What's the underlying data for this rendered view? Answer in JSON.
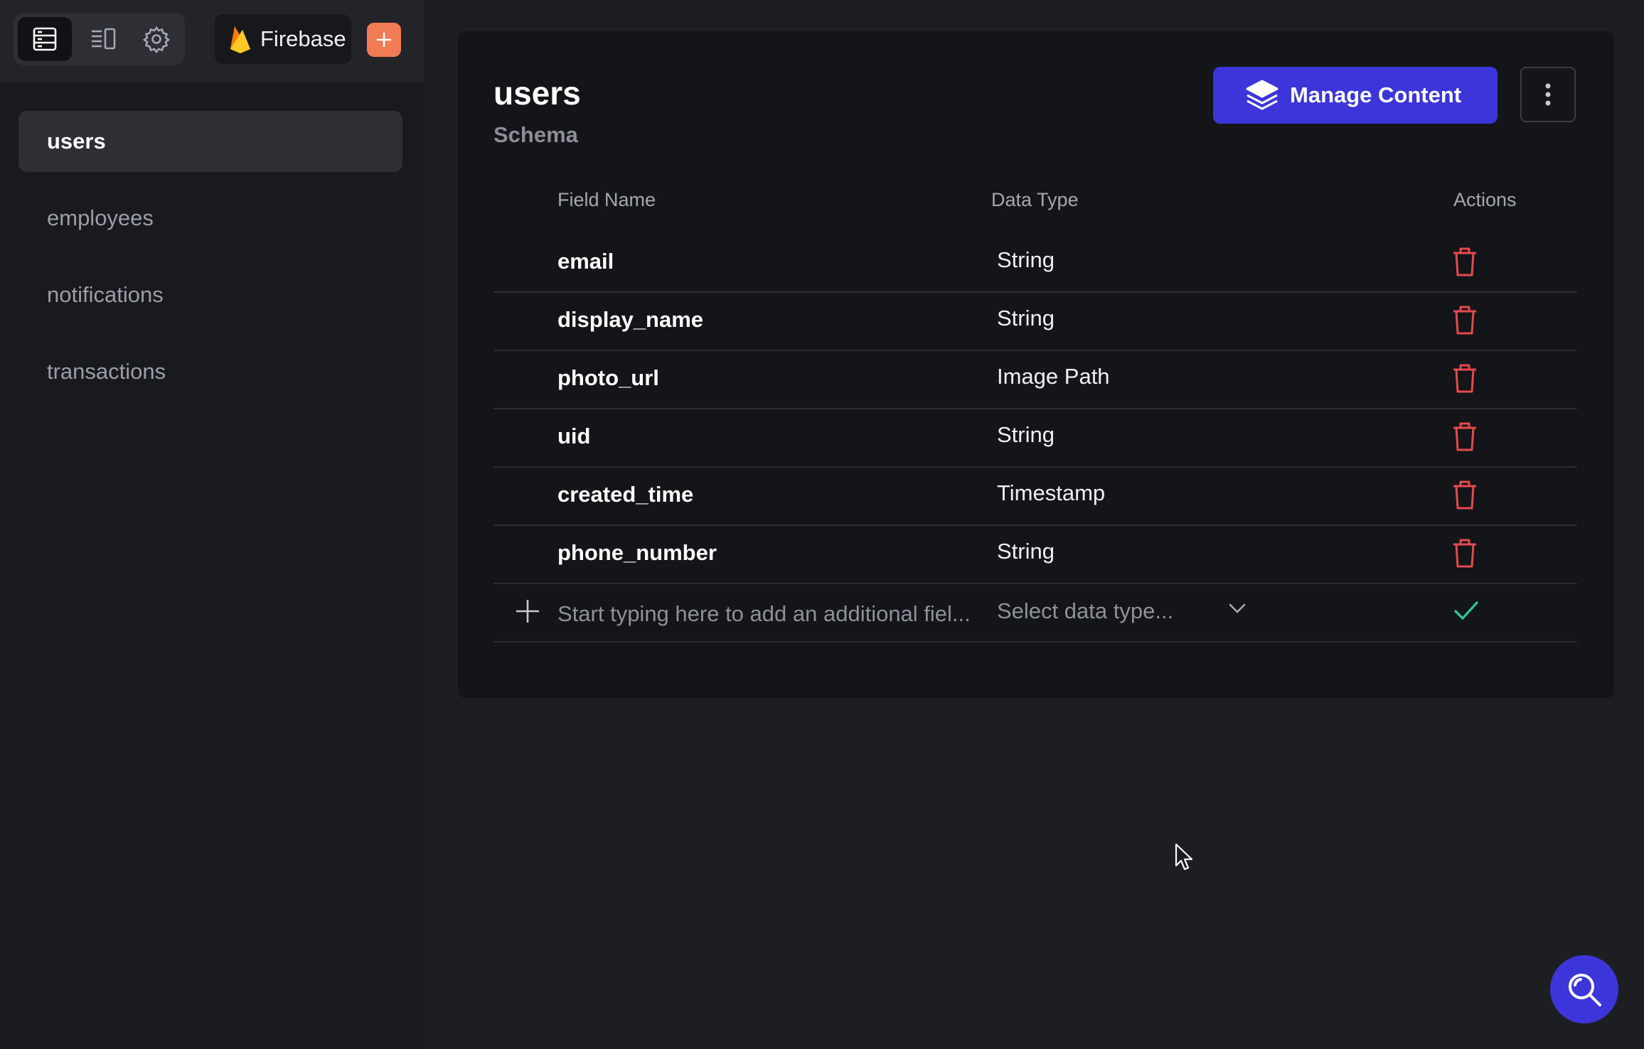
{
  "sidebar": {
    "provider_name": "Firebase",
    "collections": [
      {
        "label": "users",
        "active": true
      },
      {
        "label": "employees",
        "active": false
      },
      {
        "label": "notifications",
        "active": false
      },
      {
        "label": "transactions",
        "active": false
      }
    ]
  },
  "main": {
    "title": "users",
    "subtitle": "Schema",
    "manage_label": "Manage Content",
    "headers": {
      "field_name": "Field Name",
      "data_type": "Data Type",
      "actions": "Actions"
    },
    "fields": [
      {
        "name": "email",
        "type": "String"
      },
      {
        "name": "display_name",
        "type": "String"
      },
      {
        "name": "photo_url",
        "type": "Image Path"
      },
      {
        "name": "uid",
        "type": "String"
      },
      {
        "name": "created_time",
        "type": "Timestamp"
      },
      {
        "name": "phone_number",
        "type": "String"
      }
    ],
    "new_field": {
      "placeholder": "Start typing here to add an additional fiel...",
      "type_placeholder": "Select data type..."
    }
  },
  "colors": {
    "accent": "#3c35d9",
    "danger": "#e5484d",
    "success": "#2fbf9a",
    "firebase_orange": "#f07b55"
  }
}
